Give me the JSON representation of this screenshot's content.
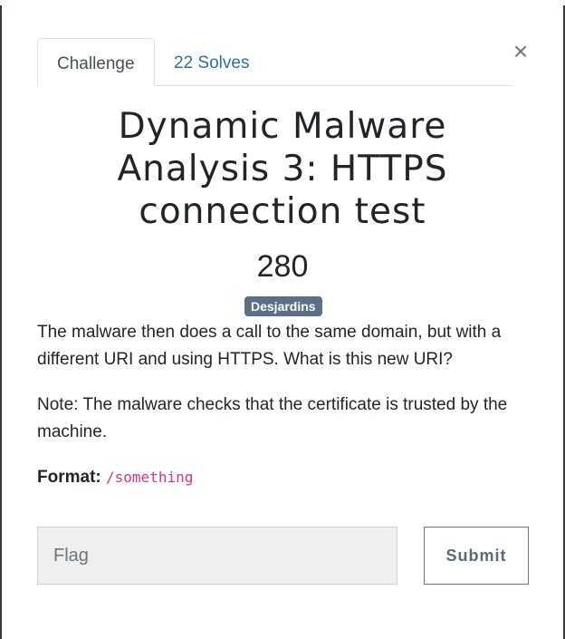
{
  "tabs": {
    "challenge_label": "Challenge",
    "solves_label": "22 Solves"
  },
  "close_label": "×",
  "challenge": {
    "title": "Dynamic Malware Analysis 3: HTTPS connection test",
    "points": "280",
    "tag": "Desjardins",
    "description": "The malware then does a call to the same domain, but with a different URI and using HTTPS. What is this new URI?",
    "note": "Note: The malware checks that the certificate is trusted by the machine.",
    "format_label": "Format:",
    "format_value": "/something"
  },
  "form": {
    "flag_placeholder": "Flag",
    "flag_value": "",
    "submit_label": "Submit"
  },
  "colors": {
    "link": "#2f6fa1",
    "tag_background": "#5a6f88",
    "code": "#d63384"
  },
  "icons": {
    "close": "close-icon"
  }
}
